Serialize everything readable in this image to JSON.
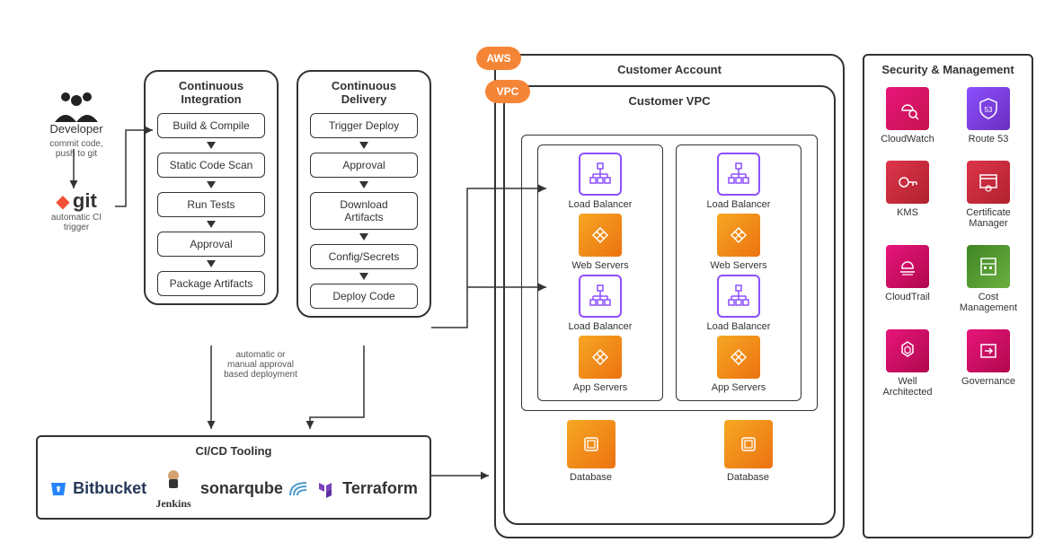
{
  "developer": {
    "label": "Developer",
    "commit_note": "commit code,\npush to git",
    "git_label": "git",
    "trigger_note": "automatic CI\ntrigger"
  },
  "ci": {
    "title": "Continuous\nIntegration",
    "steps": [
      "Build & Compile",
      "Static Code Scan",
      "Run Tests",
      "Approval",
      "Package Artifacts"
    ]
  },
  "cd": {
    "title": "Continuous\nDelivery",
    "steps": [
      "Trigger Deploy",
      "Approval",
      "Download\nArtifacts",
      "Config/Secrets",
      "Deploy Code"
    ],
    "between_note": "automatic or\nmanual approval\nbased deployment"
  },
  "tooling": {
    "title": "CI/CD Tooling",
    "items": [
      "Bitbucket",
      "Jenkins",
      "sonarqube",
      "Terraform"
    ]
  },
  "customer": {
    "account_label": "Customer Account",
    "vpc_label": "Customer VPC",
    "aws_badge": "AWS",
    "vpc_badge": "VPC",
    "stack_a": {
      "lb1": "Load Balancer",
      "web": "Web Servers",
      "lb2": "Load Balancer",
      "app": "App Servers",
      "db": "Database"
    },
    "stack_b": {
      "lb1": "Load Balancer",
      "web": "Web Servers",
      "lb2": "Load Balancer",
      "app": "App Servers",
      "db": "Database"
    }
  },
  "security": {
    "title": "Security & Management",
    "items": [
      {
        "name": "CloudWatch"
      },
      {
        "name": "Route 53"
      },
      {
        "name": "KMS"
      },
      {
        "name": "Certificate\nManager"
      },
      {
        "name": "CloudTrail"
      },
      {
        "name": "Cost\nManagement"
      },
      {
        "name": "Well\nArchitected"
      },
      {
        "name": "Governance"
      }
    ]
  },
  "icons": {
    "lb": "load-balancer-icon",
    "compute": "compute-icon",
    "db": "database-icon"
  }
}
